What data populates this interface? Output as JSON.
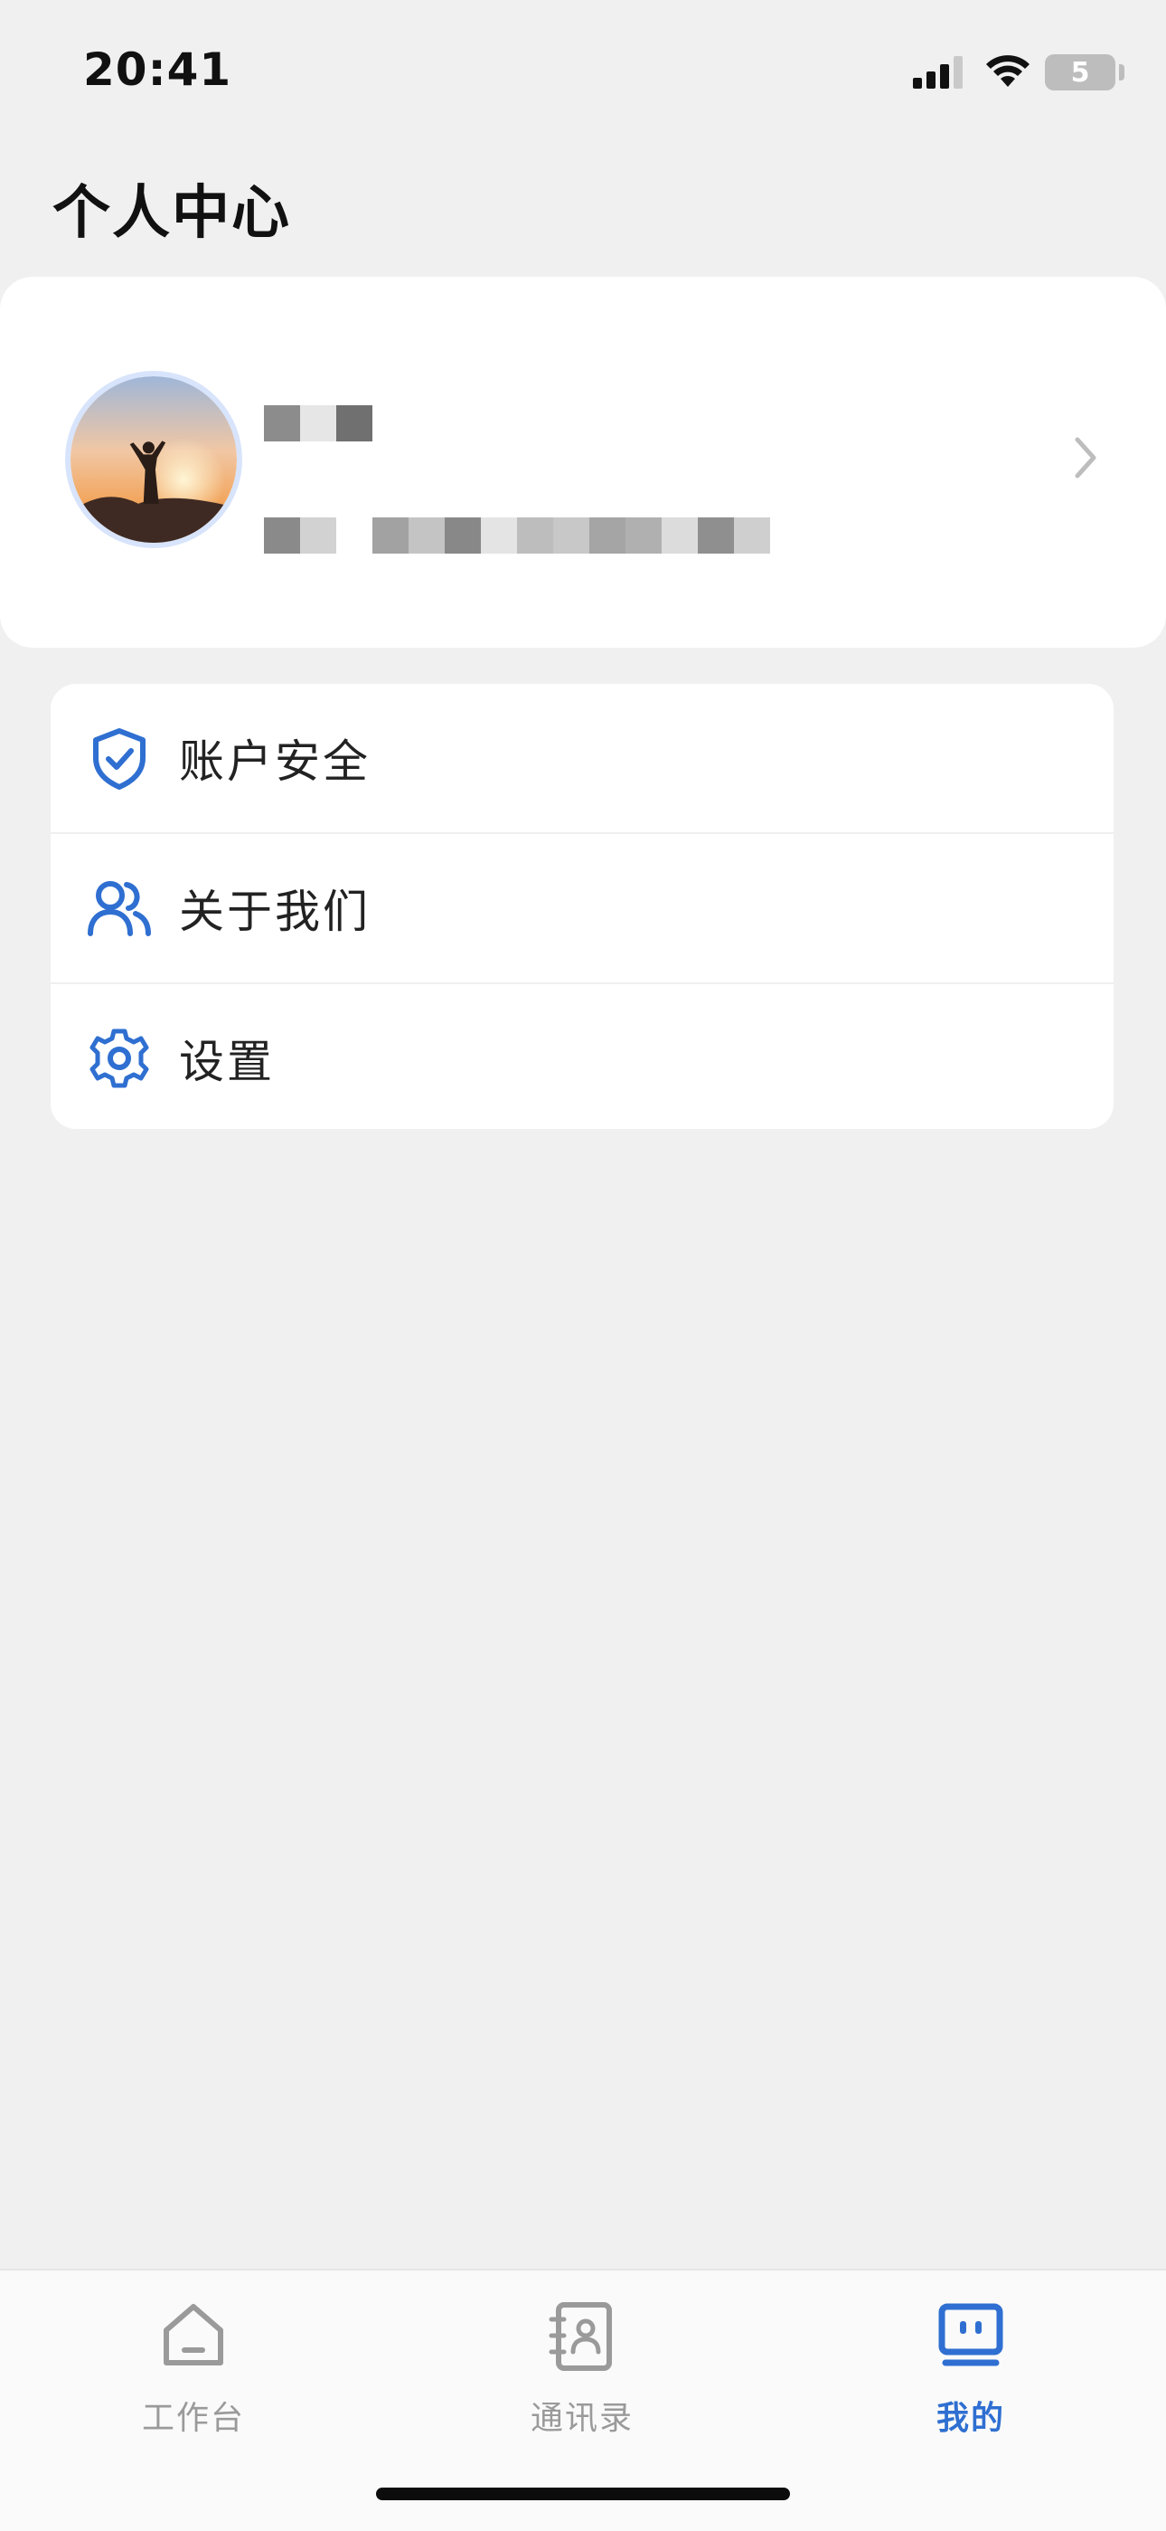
{
  "status_bar": {
    "time": "20:41",
    "battery_level": "5"
  },
  "header": {
    "title": "个人中心"
  },
  "profile": {
    "name": "",
    "detail": ""
  },
  "menu": {
    "items": [
      {
        "label": "账户安全",
        "icon": "shield-check-icon"
      },
      {
        "label": "关于我们",
        "icon": "users-icon"
      },
      {
        "label": "设置",
        "icon": "gear-icon"
      }
    ]
  },
  "tab_bar": {
    "active_tab": "我的",
    "tabs": [
      {
        "label": "工作台",
        "icon": "home-icon"
      },
      {
        "label": "通讯录",
        "icon": "contacts-book-icon"
      },
      {
        "label": "我的",
        "icon": "profile-box-icon"
      }
    ]
  },
  "colors": {
    "accent": "#2f6fd1",
    "inactive": "#9a9a9a",
    "background": "#f0f0f0",
    "card": "#ffffff"
  }
}
